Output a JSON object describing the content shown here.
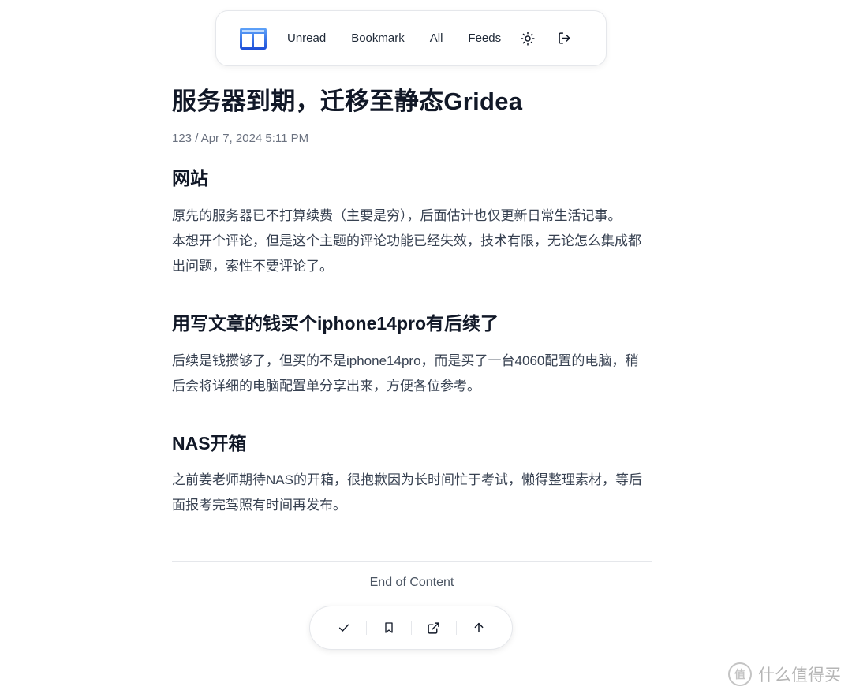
{
  "nav": {
    "items": [
      {
        "label": "Unread"
      },
      {
        "label": "Bookmark"
      },
      {
        "label": "All"
      },
      {
        "label": "Feeds"
      }
    ],
    "icons": {
      "logo": "reader-logo-icon",
      "theme": "sun-icon",
      "logout": "logout-icon"
    },
    "accent": "#3b82f6"
  },
  "article": {
    "title": "服务器到期，迁移至静态Gridea",
    "meta": "123 / Apr 7, 2024 5:11 PM",
    "sections": [
      {
        "heading": "网站",
        "paragraphs": [
          "原先的服务器已不打算续费（主要是穷），后面估计也仅更新日常生活记事。",
          "本想开个评论，但是这个主题的评论功能已经失效，技术有限，无论怎么集成都出问题，索性不要评论了。"
        ]
      },
      {
        "heading": "用写文章的钱买个iphone14pro有后续了",
        "paragraphs": [
          "后续是钱攒够了，但买的不是iphone14pro，而是买了一台4060配置的电脑，稍后会将详细的电脑配置单分享出来，方便各位参考。"
        ]
      },
      {
        "heading": "NAS开箱",
        "paragraphs": [
          "之前姜老师期待NAS的开箱，很抱歉因为长时间忙于考试，懒得整理素材，等后面报考完驾照有时间再发布。"
        ]
      }
    ]
  },
  "footer": {
    "end_text": "End of Content",
    "actions": [
      "check-icon",
      "bookmark-icon",
      "external-link-icon",
      "arrow-up-icon"
    ]
  },
  "watermark": {
    "text": "什么值得买",
    "badge": "值"
  }
}
